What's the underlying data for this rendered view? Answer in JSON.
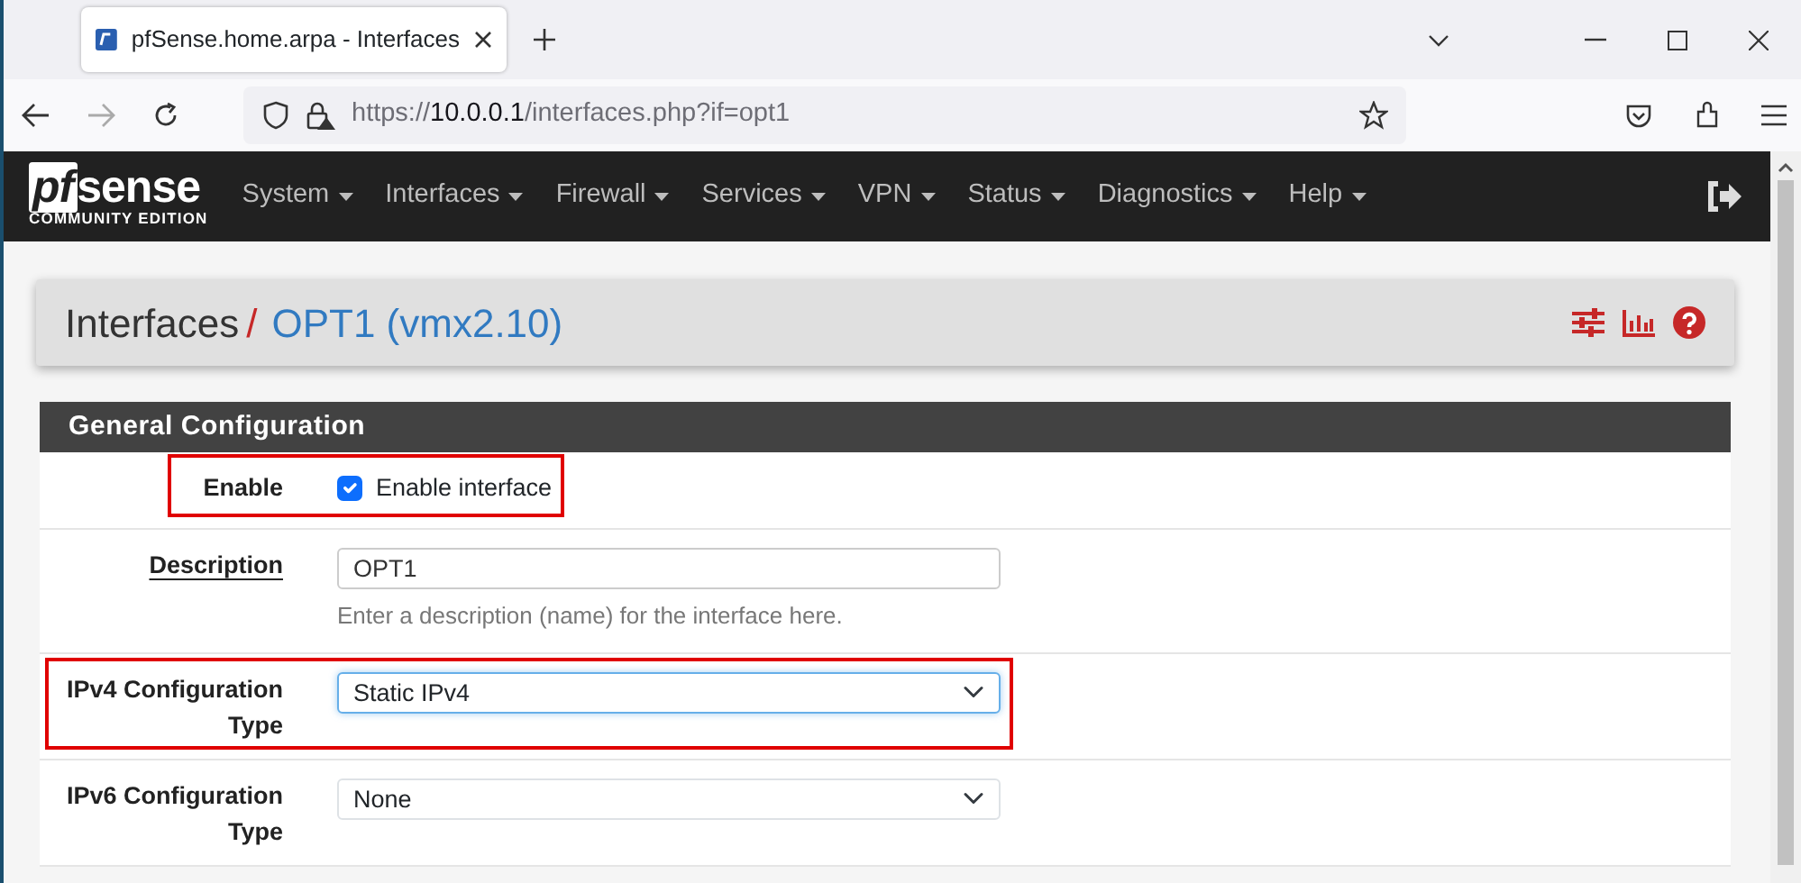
{
  "browser": {
    "tab": {
      "title": "pfSense.home.arpa - Interfaces"
    },
    "url": {
      "scheme": "https://",
      "host": "10.0.0.1",
      "path": "/interfaces.php?if=opt1"
    }
  },
  "navbar": {
    "logo": "sense",
    "logo_prefix": "pf",
    "edition": "COMMUNITY EDITION",
    "menus": [
      "System",
      "Interfaces",
      "Firewall",
      "Services",
      "VPN",
      "Status",
      "Diagnostics",
      "Help"
    ]
  },
  "breadcrumb": {
    "parent": "Interfaces",
    "separator": "/",
    "current": "OPT1 (vmx2.10)"
  },
  "panel": {
    "title": "General Configuration",
    "rows": [
      {
        "kind": "checkbox",
        "label": "Enable",
        "checkbox_label": "Enable interface",
        "checked": true,
        "highlighted": true
      },
      {
        "kind": "text",
        "label": "Description",
        "link": true,
        "value": "OPT1",
        "help": "Enter a description (name) for the interface here."
      },
      {
        "kind": "select",
        "label": "IPv4 Configuration Type",
        "value": "Static IPv4",
        "focused": true,
        "highlighted": true
      },
      {
        "kind": "select",
        "label": "IPv6 Configuration Type",
        "value": "None"
      }
    ]
  }
}
